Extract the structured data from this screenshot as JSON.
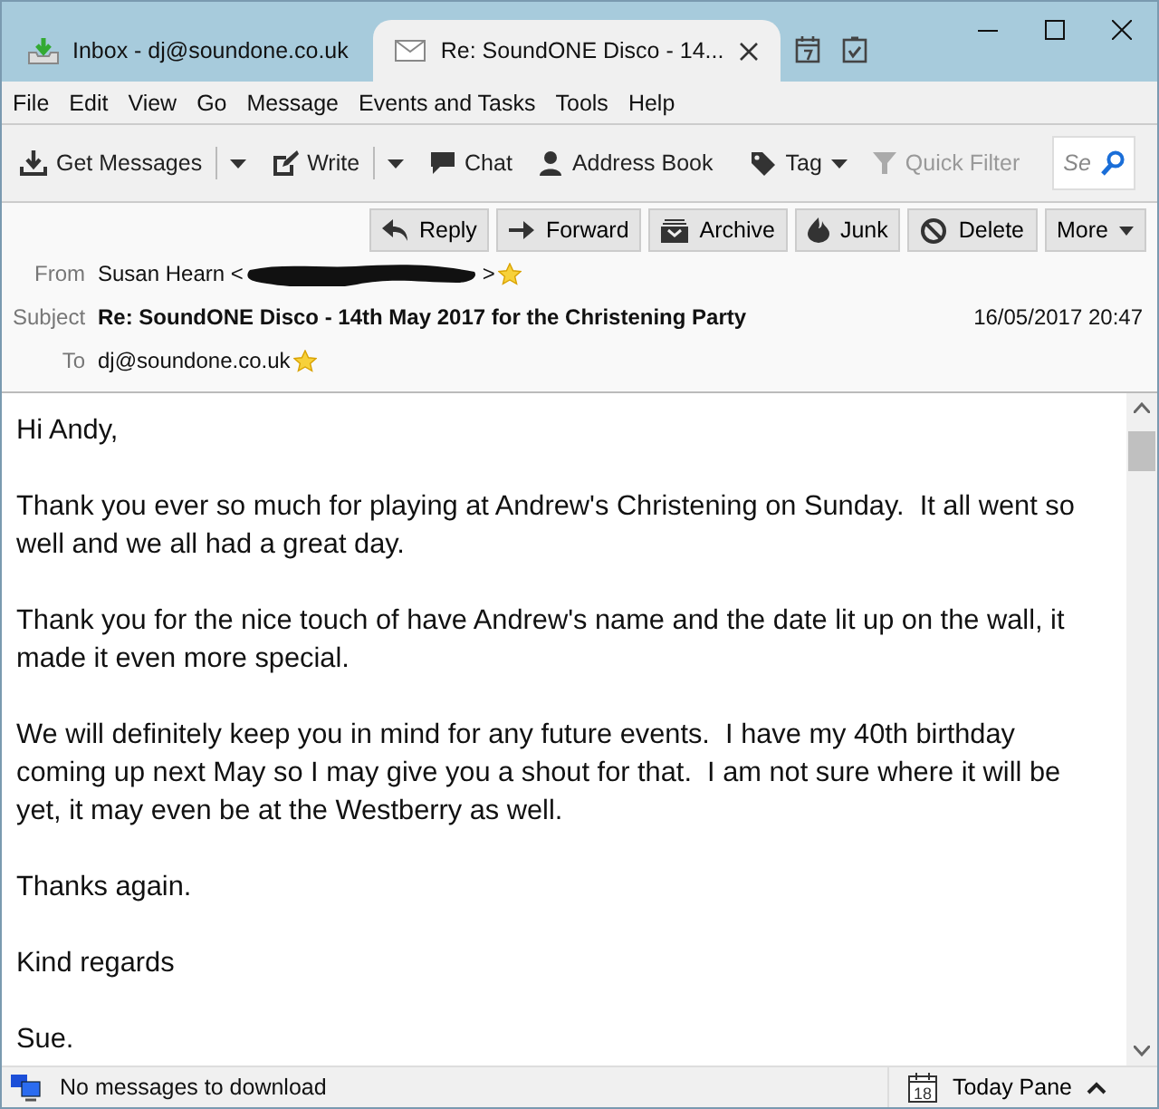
{
  "tabs": [
    {
      "label": "Inbox - dj@soundone.co.uk",
      "kind": "inbox",
      "selected": false
    },
    {
      "label": "Re: SoundONE Disco - 14...",
      "kind": "mail",
      "selected": true,
      "closable": true
    }
  ],
  "menu": [
    "File",
    "Edit",
    "View",
    "Go",
    "Message",
    "Events and Tasks",
    "Tools",
    "Help"
  ],
  "toolbar": [
    {
      "label": "Get Messages",
      "kind": "download",
      "dropdown": true,
      "disabled": false
    },
    {
      "label": "Write",
      "kind": "write",
      "dropdown": true,
      "disabled": false
    },
    {
      "label": "Chat",
      "kind": "chat",
      "dropdown": false,
      "disabled": false
    },
    {
      "label": "Address Book",
      "kind": "person",
      "dropdown": false,
      "disabled": false
    },
    {
      "label": "Tag",
      "kind": "tag",
      "dropdown": true,
      "disabled": false
    },
    {
      "label": "Quick Filter",
      "kind": "filter",
      "dropdown": false,
      "disabled": true
    }
  ],
  "search": {
    "placeholder": "Se"
  },
  "header_buttons": [
    {
      "label": "Reply",
      "kind": "reply"
    },
    {
      "label": "Forward",
      "kind": "forward"
    },
    {
      "label": "Archive",
      "kind": "archive"
    },
    {
      "label": "Junk",
      "kind": "junk"
    },
    {
      "label": "Delete",
      "kind": "delete"
    },
    {
      "label": "More",
      "kind": "more"
    }
  ],
  "from": {
    "label": "From",
    "name": "Susan Hearn <",
    "end": ">",
    "redacted": true
  },
  "subject": {
    "label": "Subject",
    "value": "Re: SoundONE Disco - 14th May 2017 for the Christening Party",
    "date": "16/05/2017 20:47"
  },
  "to": {
    "label": "To",
    "value": "dj@soundone.co.uk"
  },
  "body": [
    "Hi Andy,",
    "Thank you ever so much for playing at Andrew's Christening on Sunday.  It all went so well and we all had a great day.",
    "Thank you for the nice touch of have Andrew's name and the date lit up on the wall, it made it even more special.",
    "We will definitely keep you in mind for any future events.  I have my 40th birthday coming up next May so I may give you a shout for that.  I am not sure where it will be yet, it may even be at the Westberry as well.",
    "Thanks again.",
    "Kind regards",
    "Sue."
  ],
  "status_bar": {
    "text": "No messages to download",
    "today_pane": "Today Pane",
    "today_day": "18"
  }
}
